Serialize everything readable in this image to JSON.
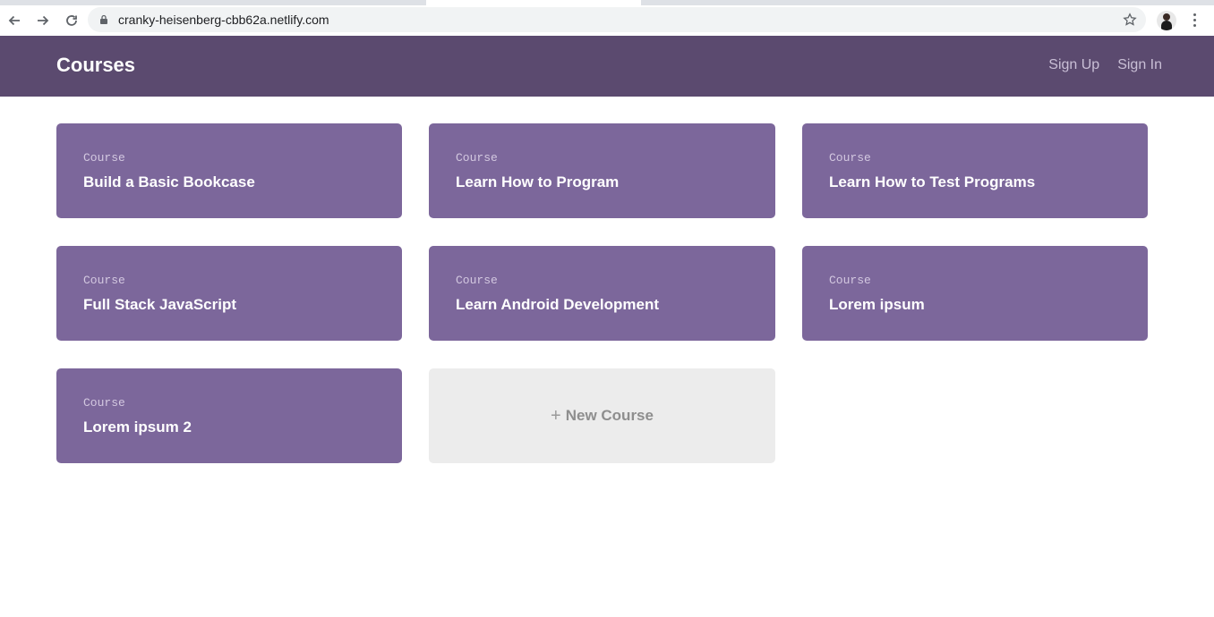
{
  "browser": {
    "url": "cranky-heisenberg-cbb62a.netlify.com",
    "icons": [
      "back-icon",
      "forward-icon",
      "reload-icon",
      "lock-icon",
      "star-icon",
      "profile-avatar",
      "more-menu-icon"
    ]
  },
  "header": {
    "title": "Courses",
    "sign_up": "Sign Up",
    "sign_in": "Sign In"
  },
  "courses": [
    {
      "label": "Course",
      "title": "Build a Basic Bookcase"
    },
    {
      "label": "Course",
      "title": "Learn How to Program"
    },
    {
      "label": "Course",
      "title": "Learn How to Test Programs"
    },
    {
      "label": "Course",
      "title": "Full Stack JavaScript"
    },
    {
      "label": "Course",
      "title": "Learn Android Development"
    },
    {
      "label": "Course",
      "title": "Lorem ipsum"
    },
    {
      "label": "Course",
      "title": "Lorem ipsum 2"
    }
  ],
  "new_course": {
    "plus": "+",
    "label": "New Course"
  },
  "colors": {
    "header_bg": "#5b4a6f",
    "card_bg": "#7c679b",
    "new_card_bg": "#ececec"
  }
}
